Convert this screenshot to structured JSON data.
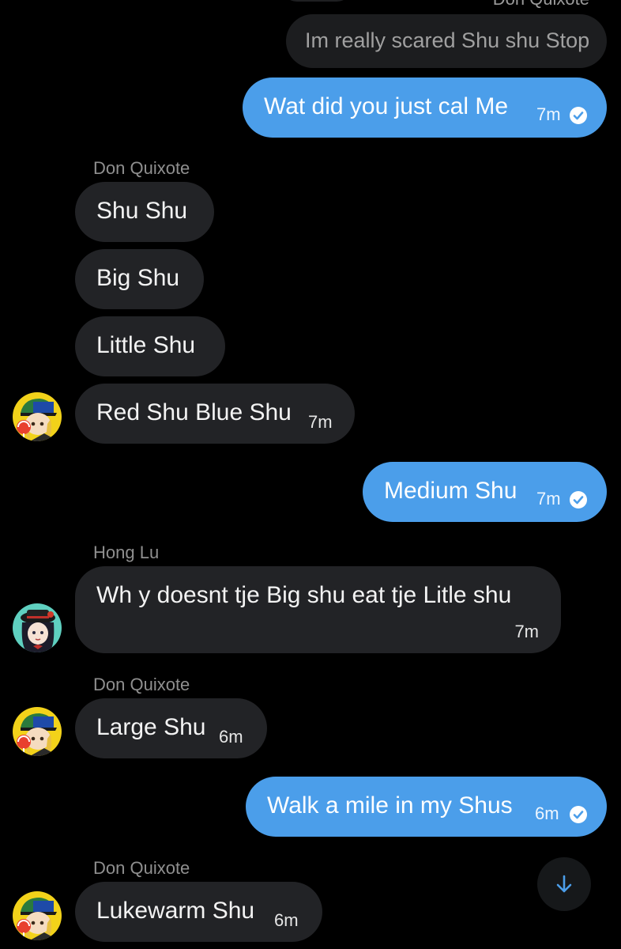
{
  "clipped_header": "Don Quixote",
  "messages": [
    {
      "text": "Im really scared Shu shu Stop"
    },
    {
      "text": "Wat did you just cal Me",
      "time": "7m"
    },
    {
      "sender": "Don Quixote"
    },
    {
      "text": "Shu Shu"
    },
    {
      "text": "Big Shu"
    },
    {
      "text": "Little Shu"
    },
    {
      "text": "Red Shu Blue Shu",
      "time": "7m"
    },
    {
      "text": "Medium Shu",
      "time": "7m"
    },
    {
      "sender": "Hong Lu"
    },
    {
      "text": "Wh y doesnt tje Big shu eat tje Litle shu",
      "time": "7m"
    },
    {
      "sender": "Don Quixote"
    },
    {
      "text": "Large Shu",
      "time": "6m"
    },
    {
      "text": "Walk a mile in my Shus",
      "time": "6m"
    },
    {
      "sender": "Don Quixote"
    },
    {
      "text": "Lukewarm Shu",
      "time": "6m"
    }
  ],
  "icons": {
    "read_receipt": "check-circle-icon",
    "scroll_down": "arrow-down-icon"
  },
  "colors": {
    "background": "#000000",
    "incoming_bubble": "#222326",
    "outgoing_bubble": "#4b9eea",
    "sender_name": "#8f8f8f",
    "accent": "#4b9eea"
  }
}
